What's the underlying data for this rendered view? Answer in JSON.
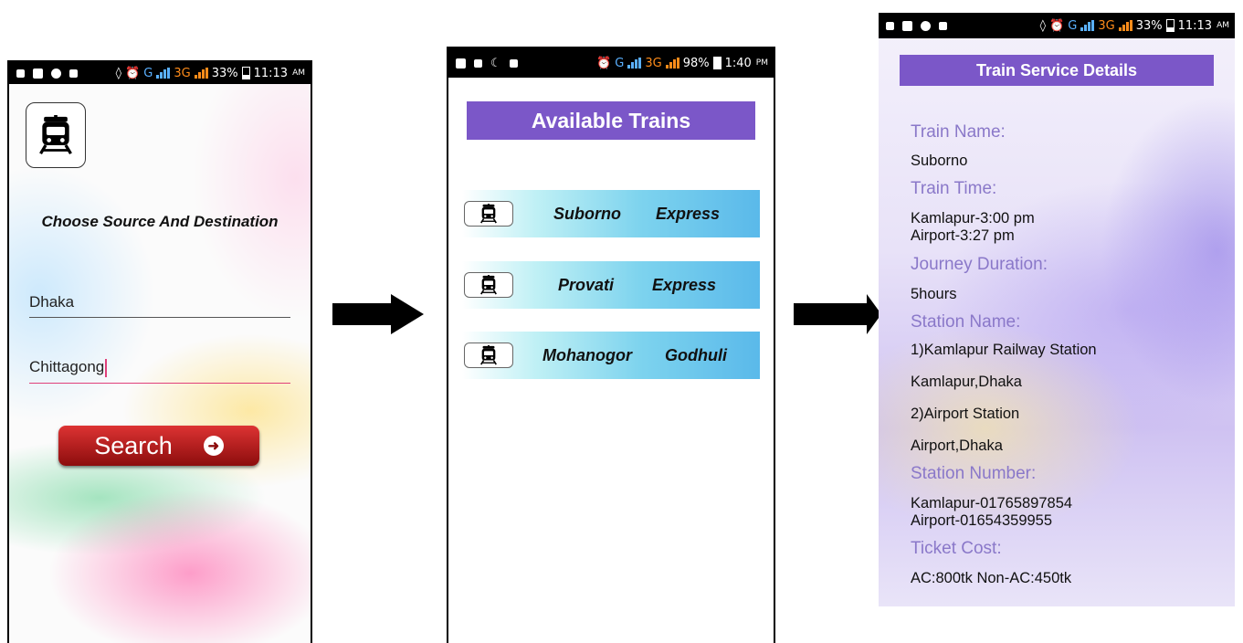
{
  "screen1": {
    "status": {
      "battery": "33%",
      "time": "11:13",
      "ampm": "AM",
      "network_g": "G",
      "network_3g": "3G"
    },
    "heading": "Choose Source And Destination",
    "source_value": "Dhaka",
    "destination_value": "Chittagong",
    "search_label": "Search"
  },
  "screen2": {
    "status": {
      "battery": "98%",
      "time": "1:40",
      "ampm": "PM",
      "network_g": "G",
      "network_3g": "3G"
    },
    "title": "Available Trains",
    "trains": [
      {
        "name": "Suborno",
        "type": "Express"
      },
      {
        "name": "Provati",
        "type": "Express"
      },
      {
        "name": "Mohanogor",
        "type": "Godhuli"
      }
    ]
  },
  "screen3": {
    "status": {
      "battery": "33%",
      "time": "11:13",
      "ampm": "AM",
      "network_g": "G",
      "network_3g": "3G"
    },
    "title": "Train Service Details",
    "train_name_label": "Train Name:",
    "train_name": "Suborno",
    "train_time_label": "Train Time:",
    "train_time_1": "Kamlapur-3:00 pm",
    "train_time_2": "Airport-3:27 pm",
    "journey_duration_label": "Journey Duration:",
    "journey_duration": "5hours",
    "station_name_label": "Station Name:",
    "station_1": "1)Kamlapur Railway Station",
    "station_1_address": "Kamlapur,Dhaka",
    "station_2": "2)Airport Station",
    "station_2_address": "Airport,Dhaka",
    "station_number_label": "Station Number:",
    "station_number_1": "Kamlapur-01765897854",
    "station_number_2": "Airport-01654359955",
    "ticket_cost_label": "Ticket Cost:",
    "ticket_cost": "AC:800tk Non-AC:450tk"
  },
  "colors": {
    "header_purple": "#7b57c8",
    "label_purple": "#8a78c9",
    "search_red": "#b31515"
  }
}
